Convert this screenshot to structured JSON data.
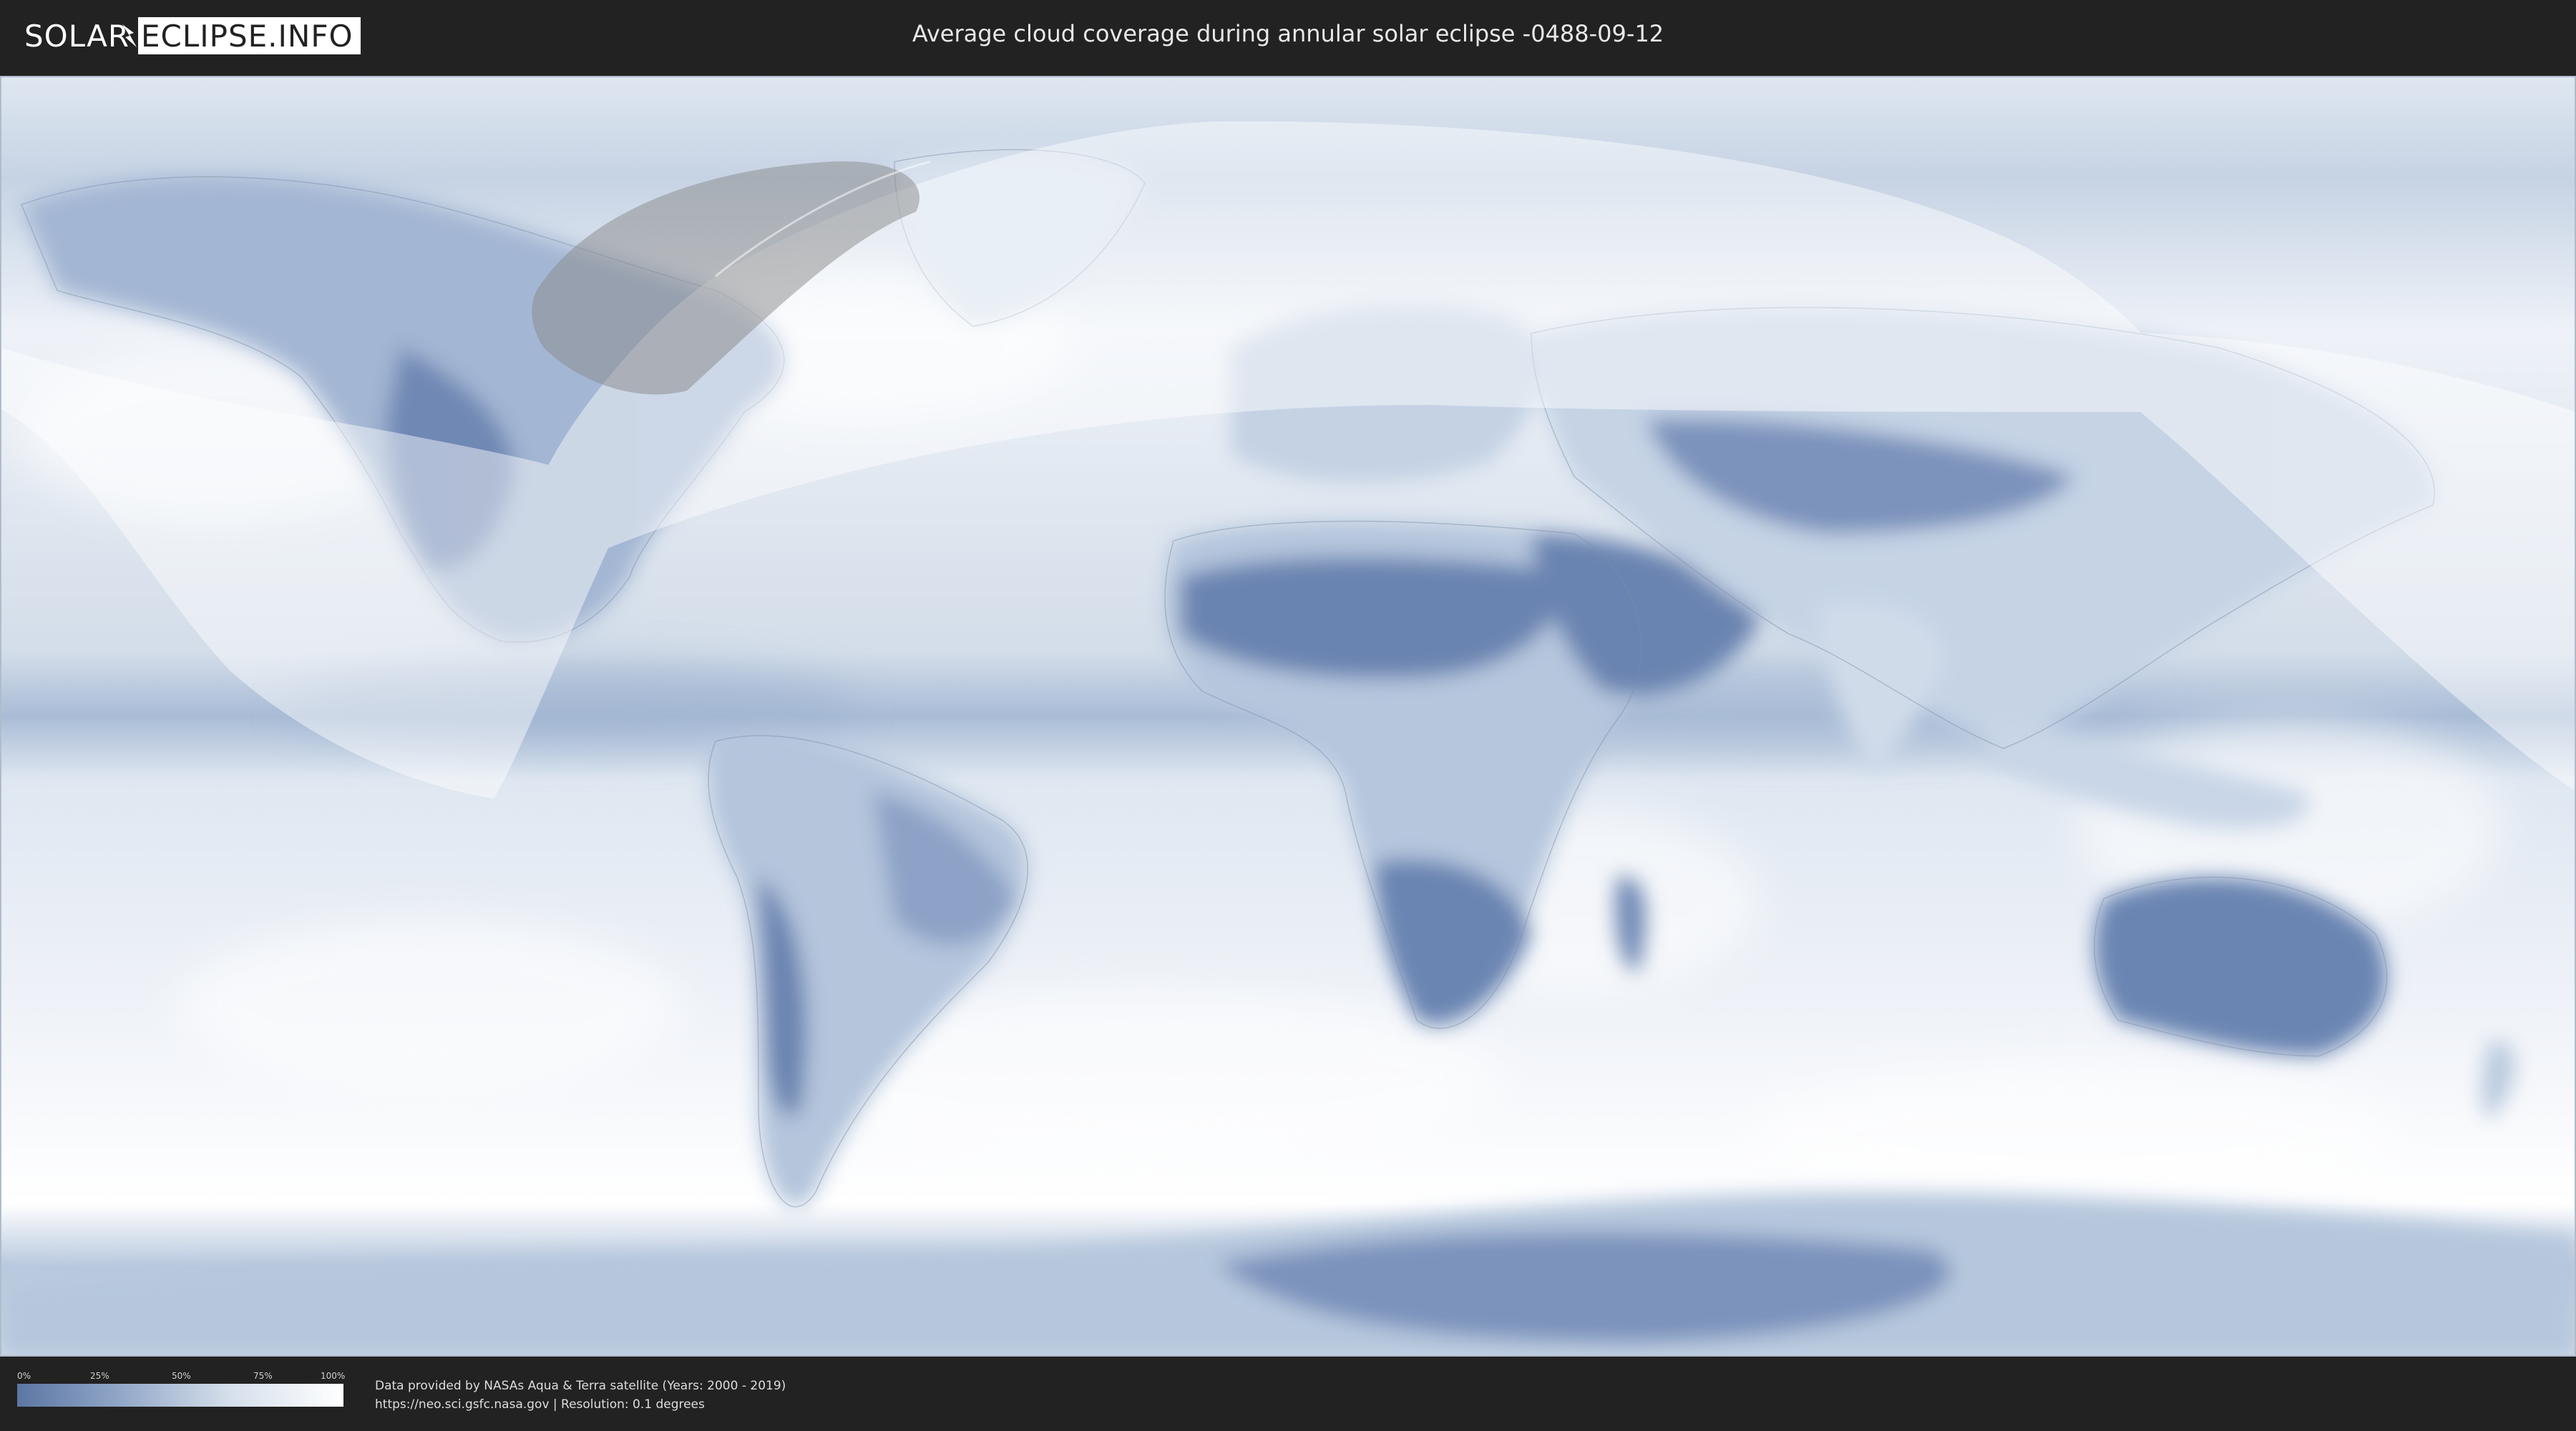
{
  "logo": {
    "part1": "SOLAR",
    "part2": "ECLIPSE.INFO"
  },
  "header": {
    "title": "Average cloud coverage during annular solar eclipse -0488-09-12"
  },
  "legend": {
    "ticks": [
      "0%",
      "25%",
      "50%",
      "75%",
      "100%"
    ],
    "low_color": "#5c76a3",
    "high_color": "#ffffff"
  },
  "credits": {
    "line1": "Data provided by NASAs Aqua & Terra satellite (Years: 2000 - 2019)",
    "line2": "https://neo.sci.gsfc.nasa.gov | Resolution: 0.1 degrees"
  },
  "map": {
    "ocean_color": "#dfe7f1",
    "clear_sky_color": "#6f88b4",
    "eclipse_zone_color": "#ffffff",
    "annular_path_color": "#8a8a8a"
  }
}
